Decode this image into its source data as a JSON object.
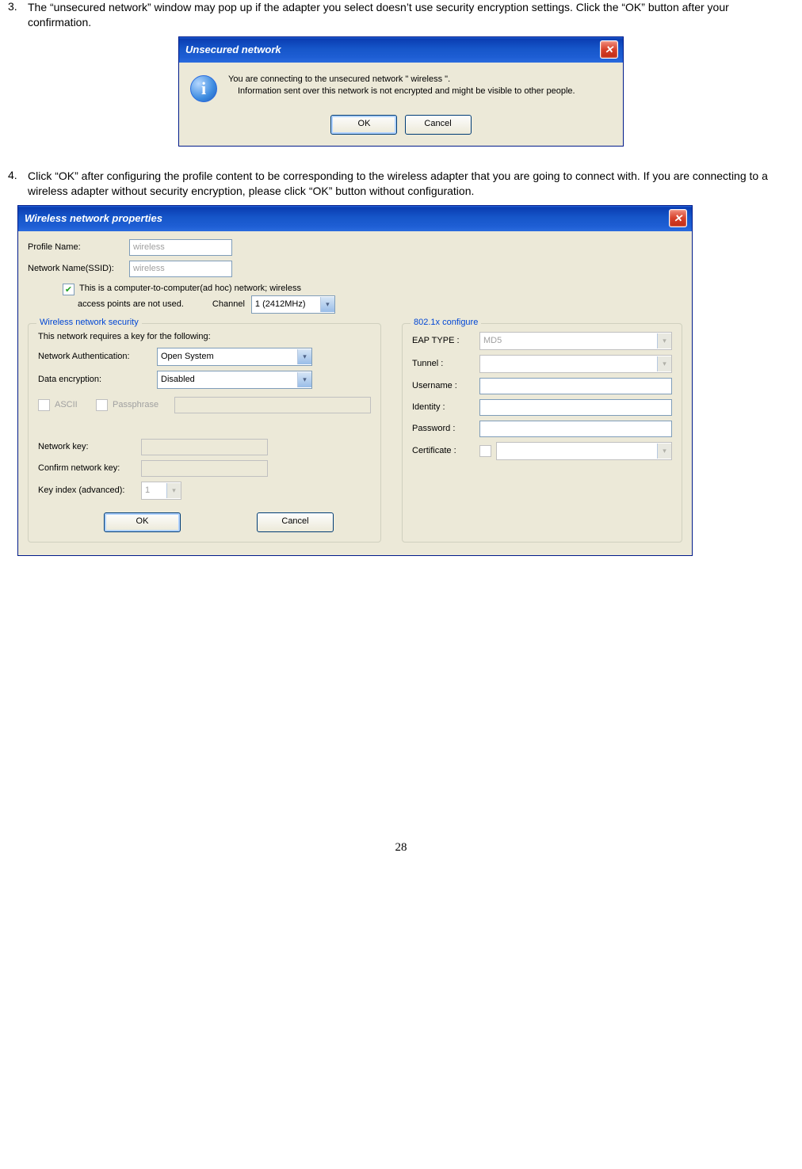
{
  "step3": {
    "num": "3.",
    "text": "The “unsecured network” window may pop up if the adapter you select doesn’t use security encryption settings. Click the “OK” button after your confirmation."
  },
  "dlg1": {
    "title": "Unsecured network",
    "msg_line1": "You are connecting to the unsecured network \" wireless \".",
    "msg_line2": "Information sent over this network is not encrypted and might be visible to other people.",
    "ok": "OK",
    "cancel": "Cancel"
  },
  "step4": {
    "num": "4.",
    "text": "Click “OK” after configuring the profile content to be corresponding to the wireless adapter that you are going to connect with. If you are connecting to a wireless adapter without security encryption, please click “OK” button without configuration."
  },
  "dlg2": {
    "title": "Wireless network properties",
    "profile_name_label": "Profile Name:",
    "profile_name_value": "wireless",
    "ssid_label": "Network Name(SSID):",
    "ssid_value": "wireless",
    "adhoc_line1": "This is a computer-to-computer(ad hoc) network; wireless",
    "adhoc_line2": "access points are not used.",
    "channel_label": "Channel",
    "channel_value": "1  (2412MHz)",
    "sec_group": "Wireless network security",
    "sec_desc": "This network requires a key for the following:",
    "auth_label": "Network Authentication:",
    "auth_value": "Open System",
    "enc_label": "Data encryption:",
    "enc_value": "Disabled",
    "ascii": "ASCII",
    "passphrase": "Passphrase",
    "netkey_label": "Network key:",
    "confirmkey_label": "Confirm network key:",
    "keyindex_label": "Key index (advanced):",
    "keyindex_value": "1",
    "cfg_group": "802.1x configure",
    "eap_label": "EAP TYPE :",
    "eap_value": "MD5",
    "tunnel_label": "Tunnel :",
    "username_label": "Username :",
    "identity_label": "Identity :",
    "password_label": "Password :",
    "cert_label": "Certificate :",
    "ok": "OK",
    "cancel": "Cancel"
  },
  "page_number": "28"
}
